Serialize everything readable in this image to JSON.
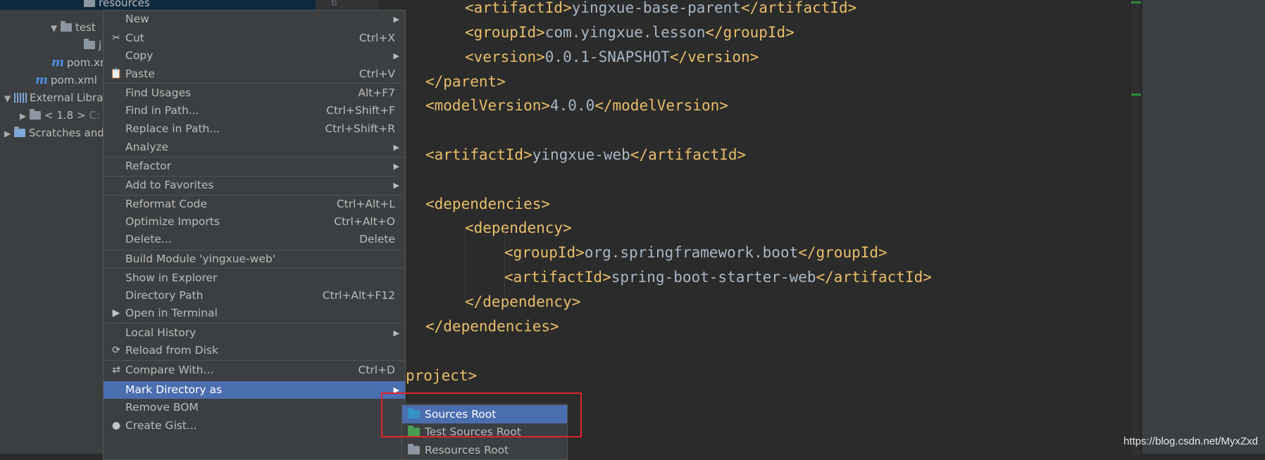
{
  "tree": {
    "rows": [
      {
        "label": "resources",
        "type": "folder"
      },
      {
        "label": "test",
        "type": "folder"
      },
      {
        "label": "j",
        "type": "folder"
      },
      {
        "label": "pom.xml",
        "type": "maven"
      },
      {
        "label": "pom.xml",
        "type": "maven"
      },
      {
        "label": "External Libra",
        "type": "libs"
      },
      {
        "label": "< 1.8 >",
        "extra": "C:",
        "type": "folder"
      },
      {
        "label": "Scratches and",
        "type": "scratch"
      }
    ]
  },
  "gutter": {
    "line_number": "6"
  },
  "editor": {
    "lines": [
      {
        "open": "<artifactId>",
        "text": "yingxue-base-parent",
        "close": "</artifactId>"
      },
      {
        "open": "<groupId>",
        "text": "com.yingxue.lesson",
        "close": "</groupId>"
      },
      {
        "open": "<version>",
        "text": "0.0.1-SNAPSHOT",
        "close": "</version>"
      },
      {
        "open": "</parent>",
        "text": "",
        "close": ""
      },
      {
        "open": "<modelVersion>",
        "text": "4.0.0",
        "close": "</modelVersion>"
      },
      {
        "open": "",
        "text": "",
        "close": ""
      },
      {
        "open": "<artifactId>",
        "text": "yingxue-web",
        "close": "</artifactId>"
      },
      {
        "open": "",
        "text": "",
        "close": ""
      },
      {
        "open": "<dependencies>",
        "text": "",
        "close": ""
      },
      {
        "open": "<dependency>",
        "text": "",
        "close": ""
      },
      {
        "open": "<groupId>",
        "text": "org.springframework.boot",
        "close": "</groupId>"
      },
      {
        "open": "<artifactId>",
        "text": "spring-boot-starter-web",
        "close": "</artifactId>"
      },
      {
        "open": "</dependency>",
        "text": "",
        "close": ""
      },
      {
        "open": "</dependencies>",
        "text": "",
        "close": ""
      },
      {
        "open": "",
        "text": "",
        "close": ""
      },
      {
        "open": "project>",
        "text": "",
        "close": ""
      }
    ]
  },
  "context_menu": {
    "items": [
      {
        "label": "New",
        "shortcut": "",
        "submenu": true,
        "icon": ""
      },
      {
        "label": "Cut",
        "shortcut": "Ctrl+X",
        "submenu": false,
        "icon": "scissors-icon"
      },
      {
        "label": "Copy",
        "shortcut": "",
        "submenu": true,
        "icon": ""
      },
      {
        "label": "Paste",
        "shortcut": "Ctrl+V",
        "submenu": false,
        "icon": "clipboard-icon"
      },
      {
        "label": "Find Usages",
        "shortcut": "Alt+F7",
        "submenu": false,
        "icon": ""
      },
      {
        "label": "Find in Path...",
        "shortcut": "Ctrl+Shift+F",
        "submenu": false,
        "icon": ""
      },
      {
        "label": "Replace in Path...",
        "shortcut": "Ctrl+Shift+R",
        "submenu": false,
        "icon": ""
      },
      {
        "label": "Analyze",
        "shortcut": "",
        "submenu": true,
        "icon": ""
      },
      {
        "label": "Refactor",
        "shortcut": "",
        "submenu": true,
        "icon": ""
      },
      {
        "label": "Add to Favorites",
        "shortcut": "",
        "submenu": true,
        "icon": ""
      },
      {
        "label": "Reformat Code",
        "shortcut": "Ctrl+Alt+L",
        "submenu": false,
        "icon": ""
      },
      {
        "label": "Optimize Imports",
        "shortcut": "Ctrl+Alt+O",
        "submenu": false,
        "icon": ""
      },
      {
        "label": "Delete...",
        "shortcut": "Delete",
        "submenu": false,
        "icon": ""
      },
      {
        "label": "Build Module 'yingxue-web'",
        "shortcut": "",
        "submenu": false,
        "icon": ""
      },
      {
        "label": "Show in Explorer",
        "shortcut": "",
        "submenu": false,
        "icon": ""
      },
      {
        "label": "Directory Path",
        "shortcut": "Ctrl+Alt+F12",
        "submenu": false,
        "icon": ""
      },
      {
        "label": "Open in Terminal",
        "shortcut": "",
        "submenu": false,
        "icon": "terminal-icon"
      },
      {
        "label": "Local History",
        "shortcut": "",
        "submenu": true,
        "icon": ""
      },
      {
        "label": "Reload from Disk",
        "shortcut": "",
        "submenu": false,
        "icon": "reload-icon"
      },
      {
        "label": "Compare With...",
        "shortcut": "Ctrl+D",
        "submenu": false,
        "icon": "compare-icon"
      },
      {
        "label": "Mark Directory as",
        "shortcut": "",
        "submenu": true,
        "icon": "",
        "highlighted": true
      },
      {
        "label": "Remove BOM",
        "shortcut": "",
        "submenu": false,
        "icon": ""
      },
      {
        "label": "Create Gist...",
        "shortcut": "",
        "submenu": false,
        "icon": "github-icon"
      }
    ]
  },
  "submenu": {
    "items": [
      {
        "label": "Sources Root",
        "color": "#3592c4",
        "highlighted": true
      },
      {
        "label": "Test Sources Root",
        "color": "#499c54"
      },
      {
        "label": "Resources Root",
        "color": "#8c96a0"
      }
    ]
  },
  "watermark": "https://blog.csdn.net/MyxZxd",
  "colors": {
    "accent": "#4b6eaf",
    "highlight_box": "#e0252b",
    "xml_tag": "#e8bf6a",
    "xml_text": "#a9b7c6"
  }
}
